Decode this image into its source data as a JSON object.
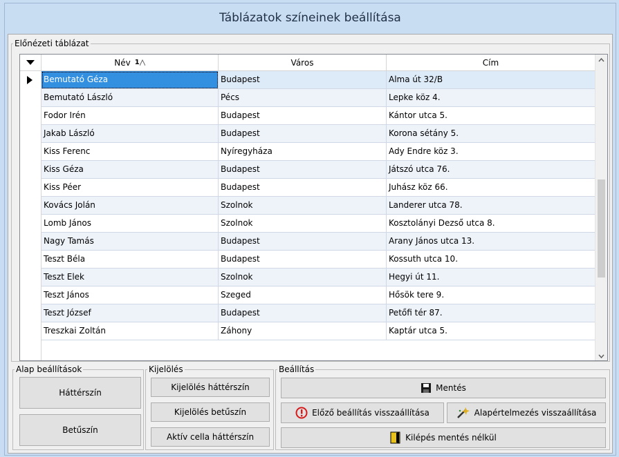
{
  "window": {
    "title": "Táblázatok színeinek beállítása"
  },
  "preview": {
    "legend": "Előnézeti táblázat",
    "columns": [
      {
        "label": "Név",
        "sort_indicator": "1"
      },
      {
        "label": "Város"
      },
      {
        "label": "Cím"
      }
    ],
    "rows": [
      [
        "Bemutató Géza",
        "Budapest",
        "Alma út 32/B"
      ],
      [
        "Bemutató László",
        "Pécs",
        "Lepke köz 4."
      ],
      [
        "Fodor Irén",
        "Budapest",
        "Kántor utca 5."
      ],
      [
        "Jakab László",
        "Budapest",
        "Korona sétány 5."
      ],
      [
        "Kiss Ferenc",
        "Nyíregyháza",
        "Ady Endre köz 3."
      ],
      [
        "Kiss Géza",
        "Budapest",
        "Játszó utca 76."
      ],
      [
        "Kiss Péer",
        "Budapest",
        "Juhász köz 66."
      ],
      [
        "Kovács Jolán",
        "Szolnok",
        "Landerer utca 78."
      ],
      [
        "Lomb János",
        "Szolnok",
        "Kosztolányi Dezső utca 8."
      ],
      [
        "Nagy Tamás",
        "Budapest",
        "Arany János utca 13."
      ],
      [
        "Teszt Béla",
        "Budapest",
        "Kossuth utca 10."
      ],
      [
        "Teszt Elek",
        "Szolnok",
        "Hegyi út 11."
      ],
      [
        "Teszt János",
        "Szeged",
        "Hősök tere 9."
      ],
      [
        "Teszt József",
        "Budapest",
        "Petőfi tér 87."
      ],
      [
        "Treszkai Zoltán",
        "Záhony",
        "Kaptár utca 5."
      ]
    ],
    "current_row": 0
  },
  "basic": {
    "legend": "Alap beállítások",
    "background_btn": "Háttérszín",
    "font_btn": "Betűszín"
  },
  "selection": {
    "legend": "Kijelölés",
    "sel_bg_btn": "Kijelölés háttérszín",
    "sel_font_btn": "Kijelölés betűszín",
    "active_bg_btn": "Aktív cella háttérszín"
  },
  "settings": {
    "legend": "Beállítás",
    "save_btn": "Mentés",
    "restore_prev_btn": "Előző beállítás visszaállítása",
    "restore_default_btn": "Alapértelmezés visszaállítása",
    "exit_btn": "Kilépés mentés nélkül"
  },
  "colors": {
    "title_bg": "#c9ddf2",
    "alt_row": "#eef3fa",
    "current_row": "#ddeaf8",
    "active_cell": "#3390e0"
  }
}
